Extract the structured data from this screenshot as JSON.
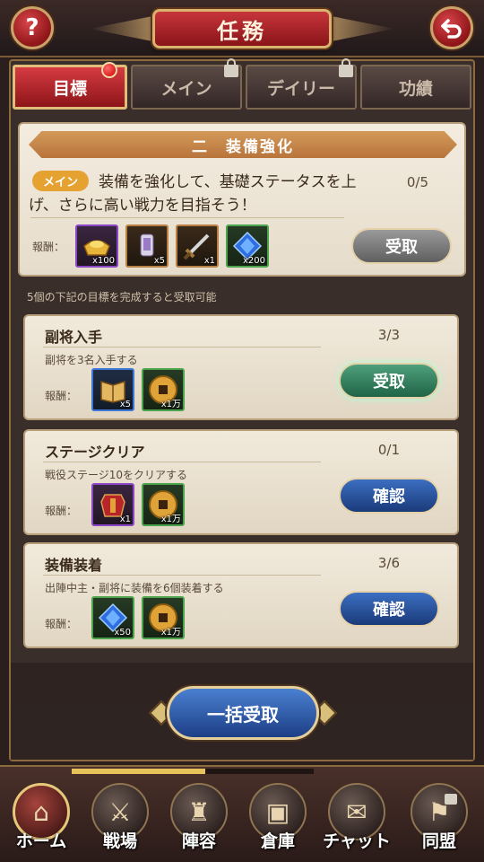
{
  "header": {
    "title": "任務",
    "help_icon": "question-mark-icon",
    "back_icon": "back-arrow-icon"
  },
  "tabs": [
    {
      "label": "目標",
      "active": true,
      "badge": true,
      "locked": false
    },
    {
      "label": "メイン",
      "active": false,
      "locked": true
    },
    {
      "label": "デイリー",
      "active": false,
      "locked": true
    },
    {
      "label": "功績",
      "active": false,
      "locked": false
    }
  ],
  "goal": {
    "banner": "二　装備強化",
    "tag": "メイン",
    "description": "装備を強化して、基礎ステータスを上げ、さらに高い戦力を目指そう！",
    "progress": "0/5",
    "reward_label": "報酬：",
    "rewards": [
      {
        "icon": "gold-ingot-icon",
        "qty": "x100",
        "rarity": "purple"
      },
      {
        "icon": "scroll-icon",
        "qty": "x5",
        "rarity": "orange"
      },
      {
        "icon": "sword-icon",
        "qty": "x1",
        "rarity": "orange"
      },
      {
        "icon": "blue-gem-icon",
        "qty": "x200",
        "rarity": "green"
      }
    ],
    "button": "受取"
  },
  "info_text": "5個の下記の目標を完成すると受取可能",
  "missions": [
    {
      "title": "副将入手",
      "progress": "3/3",
      "desc": "副将を3名入手する",
      "reward_label": "報酬：",
      "rewards": [
        {
          "icon": "book-icon",
          "qty": "x5",
          "rarity": "blue"
        },
        {
          "icon": "coin-icon",
          "qty": "x1万",
          "rarity": "green"
        }
      ],
      "button": "受取",
      "button_style": "green"
    },
    {
      "title": "ステージクリア",
      "progress": "0/1",
      "desc": "戦役ステージ10をクリアする",
      "reward_label": "報酬：",
      "rewards": [
        {
          "icon": "armor-icon",
          "qty": "x1",
          "rarity": "purple"
        },
        {
          "icon": "coin-icon",
          "qty": "x1万",
          "rarity": "green"
        }
      ],
      "button": "確認",
      "button_style": "blue"
    },
    {
      "title": "装備装着",
      "progress": "3/6",
      "desc": "出陣中主・副将に装備を6個装着する",
      "reward_label": "報酬：",
      "rewards": [
        {
          "icon": "blue-gem-icon",
          "qty": "x50",
          "rarity": "green"
        },
        {
          "icon": "coin-icon",
          "qty": "x1万",
          "rarity": "green"
        }
      ],
      "button": "確認",
      "button_style": "blue"
    }
  ],
  "bulk_button": "一括受取",
  "nav": {
    "progress": 0.55,
    "items": [
      {
        "label": "ホーム",
        "icon": "home-icon",
        "active": true
      },
      {
        "label": "戦場",
        "icon": "battlefield-icon",
        "active": false
      },
      {
        "label": "陣容",
        "icon": "formation-icon",
        "active": false
      },
      {
        "label": "倉庫",
        "icon": "warehouse-icon",
        "active": false
      },
      {
        "label": "チャット",
        "icon": "chat-icon",
        "active": false
      },
      {
        "label": "同盟",
        "icon": "alliance-icon",
        "active": false,
        "locked": true
      }
    ]
  }
}
